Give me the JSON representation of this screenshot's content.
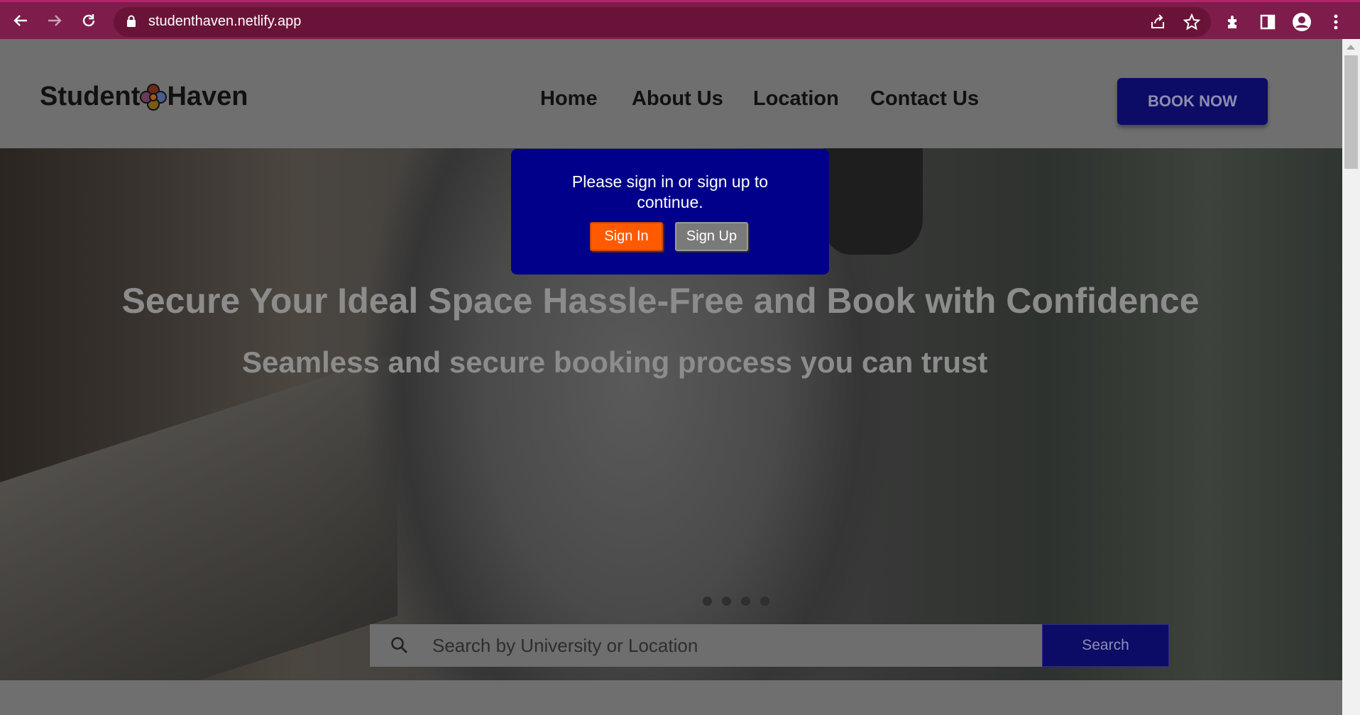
{
  "browser": {
    "url": "studenthaven.netlify.app",
    "icons": [
      "back-arrow-icon",
      "forward-arrow-icon",
      "reload-icon",
      "lock-icon",
      "share-icon",
      "star-icon",
      "extensions-icon",
      "side-panel-icon",
      "profile-icon",
      "menu-icon"
    ]
  },
  "site": {
    "logo_left": "Student",
    "logo_right": "Haven",
    "nav": [
      {
        "label": "Home"
      },
      {
        "label": "About Us"
      },
      {
        "label": "Location"
      },
      {
        "label": "Contact Us"
      }
    ],
    "book_now": "BOOK NOW"
  },
  "hero": {
    "title": "Secure Your Ideal Space Hassle-Free and Book with Confidence",
    "subtitle": "Seamless and secure booking process you can trust",
    "slides_count": 4
  },
  "search": {
    "placeholder": "Search by University or Location",
    "value": "",
    "button": "Search"
  },
  "modal": {
    "message": "Please sign in or sign up to continue.",
    "sign_in": "Sign In",
    "sign_up": "Sign Up"
  },
  "colors": {
    "browser_bar": "#7e1c4b",
    "navy": "#0c0b66",
    "modal_bg": "#00008b",
    "sign_in": "#ff5a00",
    "sign_up": "#7a7a7a"
  }
}
